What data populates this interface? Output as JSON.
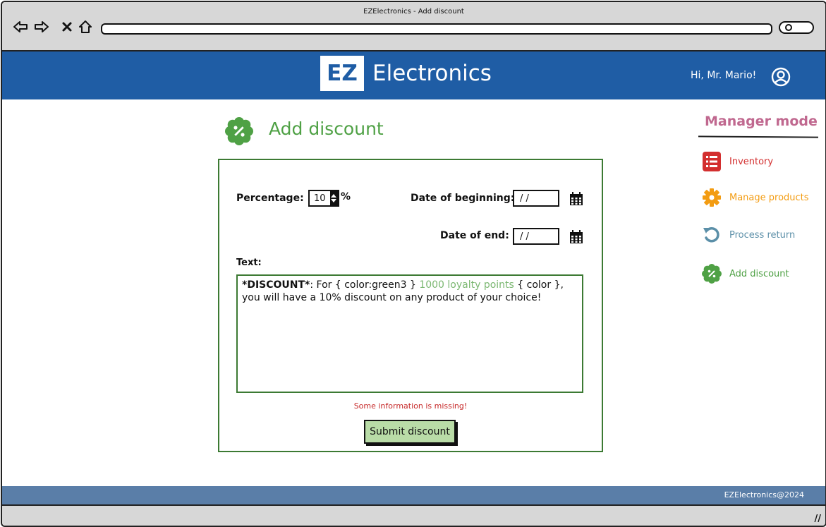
{
  "window": {
    "title": "EZElectronics - Add discount"
  },
  "header": {
    "logo_mark": "EZ",
    "logo_text": "Electronics",
    "greeting": "Hi, Mr. Mario!"
  },
  "sidebar": {
    "title": "Manager mode",
    "title_color": "#c0688f",
    "items": [
      {
        "label": "Inventory",
        "icon": "list-icon",
        "color": "#d32f2f"
      },
      {
        "label": "Manage products",
        "icon": "gear-icon",
        "color": "#f39c12"
      },
      {
        "label": "Process return",
        "icon": "undo-icon",
        "color": "#5b8fa8"
      },
      {
        "label": "Add discount",
        "icon": "discount-badge-icon",
        "color": "#4fa145"
      }
    ]
  },
  "page": {
    "title": "Add discount",
    "title_color": "#4fa145"
  },
  "form": {
    "percentage_label": "Percentage:",
    "percentage_value": "10",
    "percentage_unit": "%",
    "date_begin_label": "Date of beginning:",
    "date_begin_value": "/ /",
    "date_end_label": "Date of end:",
    "date_end_value": "/ /",
    "text_label": "Text:",
    "text_bold": "*DISCOUNT*",
    "text_part1": ":  For { color:green3 } ",
    "text_green": "1000 loyalty points",
    "text_part2": " { color }, you will have a 10% discount on any product of your choice!",
    "error_message": "Some information is missing!",
    "submit_label": "Submit discount"
  },
  "footer": {
    "text": "EZElectronics@2024"
  },
  "colors": {
    "header_bg": "#1f5da5",
    "footer_bg": "#5a7ea8",
    "form_border": "#3c7a33",
    "error": "#c62828"
  }
}
